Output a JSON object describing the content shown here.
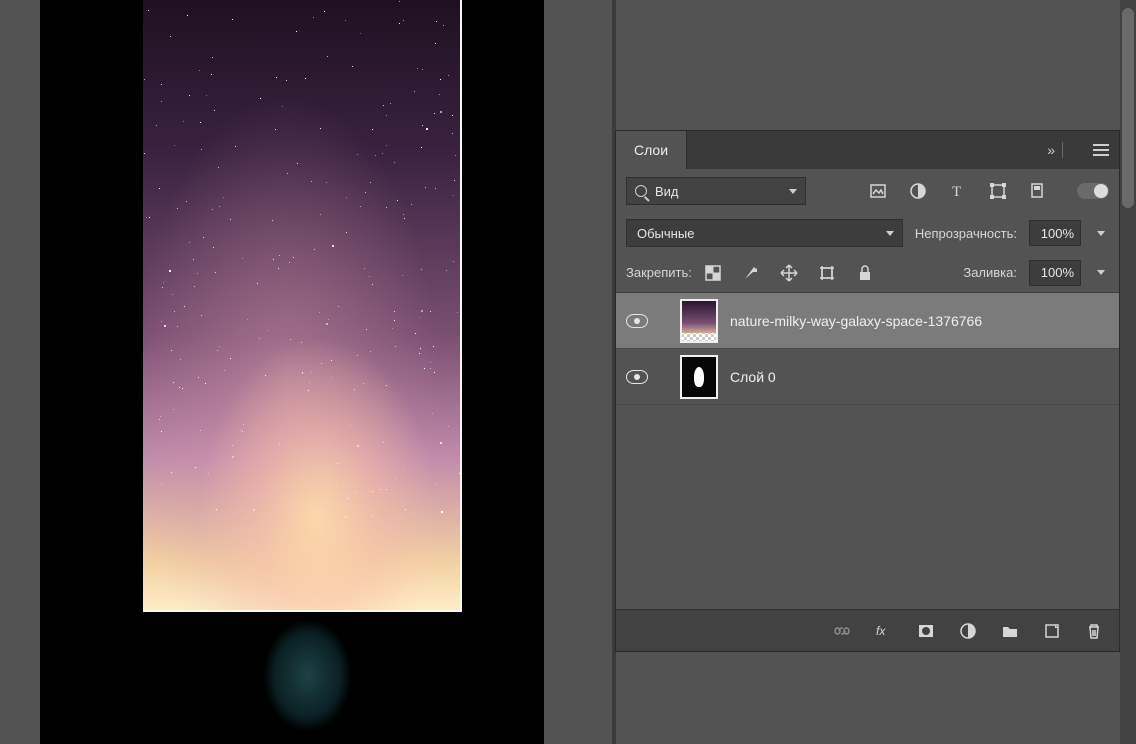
{
  "panel": {
    "title": "Слои",
    "filter": {
      "label": "Вид"
    },
    "blend_mode": "Обычные",
    "opacity": {
      "label": "Непрозрачность:",
      "value": "100%"
    },
    "fill": {
      "label": "Заливка:",
      "value": "100%"
    },
    "lock": {
      "label": "Закрепить:"
    }
  },
  "layers": [
    {
      "name": "nature-milky-way-galaxy-space-1376766",
      "selected": true,
      "thumb": "sky"
    },
    {
      "name": "Слой 0",
      "selected": false,
      "thumb": "face"
    }
  ]
}
